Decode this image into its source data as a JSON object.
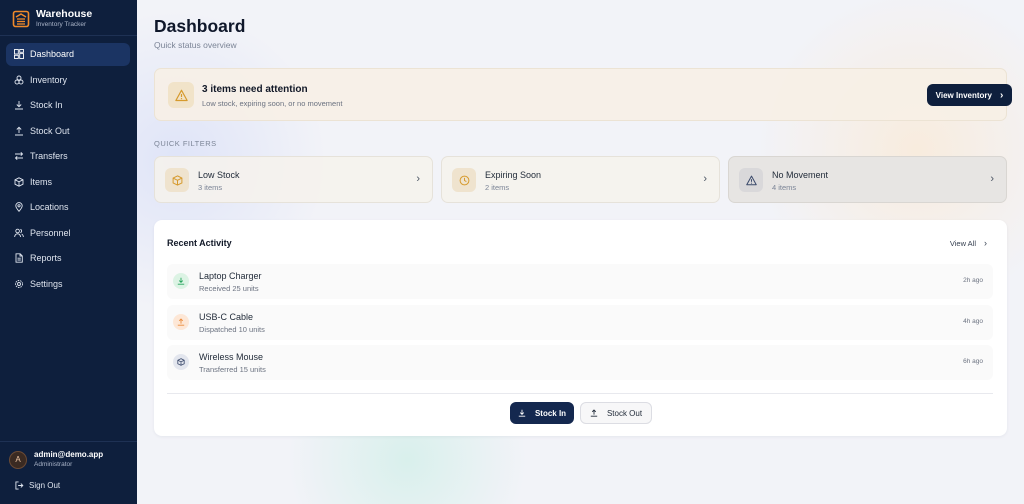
{
  "brand": {
    "title": "Warehouse",
    "subtitle": "Inventory Tracker"
  },
  "nav": [
    {
      "label": "Dashboard",
      "icon": "dashboard-icon",
      "active": true
    },
    {
      "label": "Inventory",
      "icon": "boxes-icon"
    },
    {
      "label": "Stock In",
      "icon": "download-icon"
    },
    {
      "label": "Stock Out",
      "icon": "upload-icon"
    },
    {
      "label": "Transfers",
      "icon": "transfer-icon"
    },
    {
      "label": "Items",
      "icon": "package-icon"
    },
    {
      "label": "Locations",
      "icon": "map-pin-icon"
    },
    {
      "label": "Personnel",
      "icon": "users-icon"
    },
    {
      "label": "Reports",
      "icon": "report-icon"
    },
    {
      "label": "Settings",
      "icon": "gear-icon"
    }
  ],
  "user": {
    "initial": "A",
    "email": "admin@demo.app",
    "role": "Administrator",
    "signout": "Sign Out"
  },
  "header": {
    "title": "Dashboard",
    "subtitle": "Quick status overview"
  },
  "alert": {
    "title": "3 items need attention",
    "subtitle": "Low stock, expiring soon, or no movement",
    "button": "View Inventory"
  },
  "quick_filters": {
    "label": "QUICK FILTERS",
    "cards": [
      {
        "title": "Low Stock",
        "count": "3 items",
        "icon": "package-icon"
      },
      {
        "title": "Expiring Soon",
        "count": "2 items",
        "icon": "clock-icon"
      },
      {
        "title": "No Movement",
        "count": "4 items",
        "icon": "warning-icon"
      }
    ]
  },
  "activity": {
    "title": "Recent Activity",
    "view_all": "View All",
    "rows": [
      {
        "name": "Laptop Charger",
        "desc": "Received 25 units",
        "time": "2h ago",
        "icon": "download-icon",
        "color": "#22a35a"
      },
      {
        "name": "USB-C Cable",
        "desc": "Dispatched 10 units",
        "time": "4h ago",
        "icon": "upload-icon",
        "color": "#ea8a3a"
      },
      {
        "name": "Wireless Mouse",
        "desc": "Transferred 15 units",
        "time": "6h ago",
        "icon": "package-icon",
        "color": "#3b4a6b"
      }
    ],
    "stock_in": "Stock In",
    "stock_out": "Stock Out"
  },
  "colors": {
    "sidebar": "#0e1f3d",
    "active_nav": "#1b3463",
    "accent_amber": "#d69a2d"
  }
}
